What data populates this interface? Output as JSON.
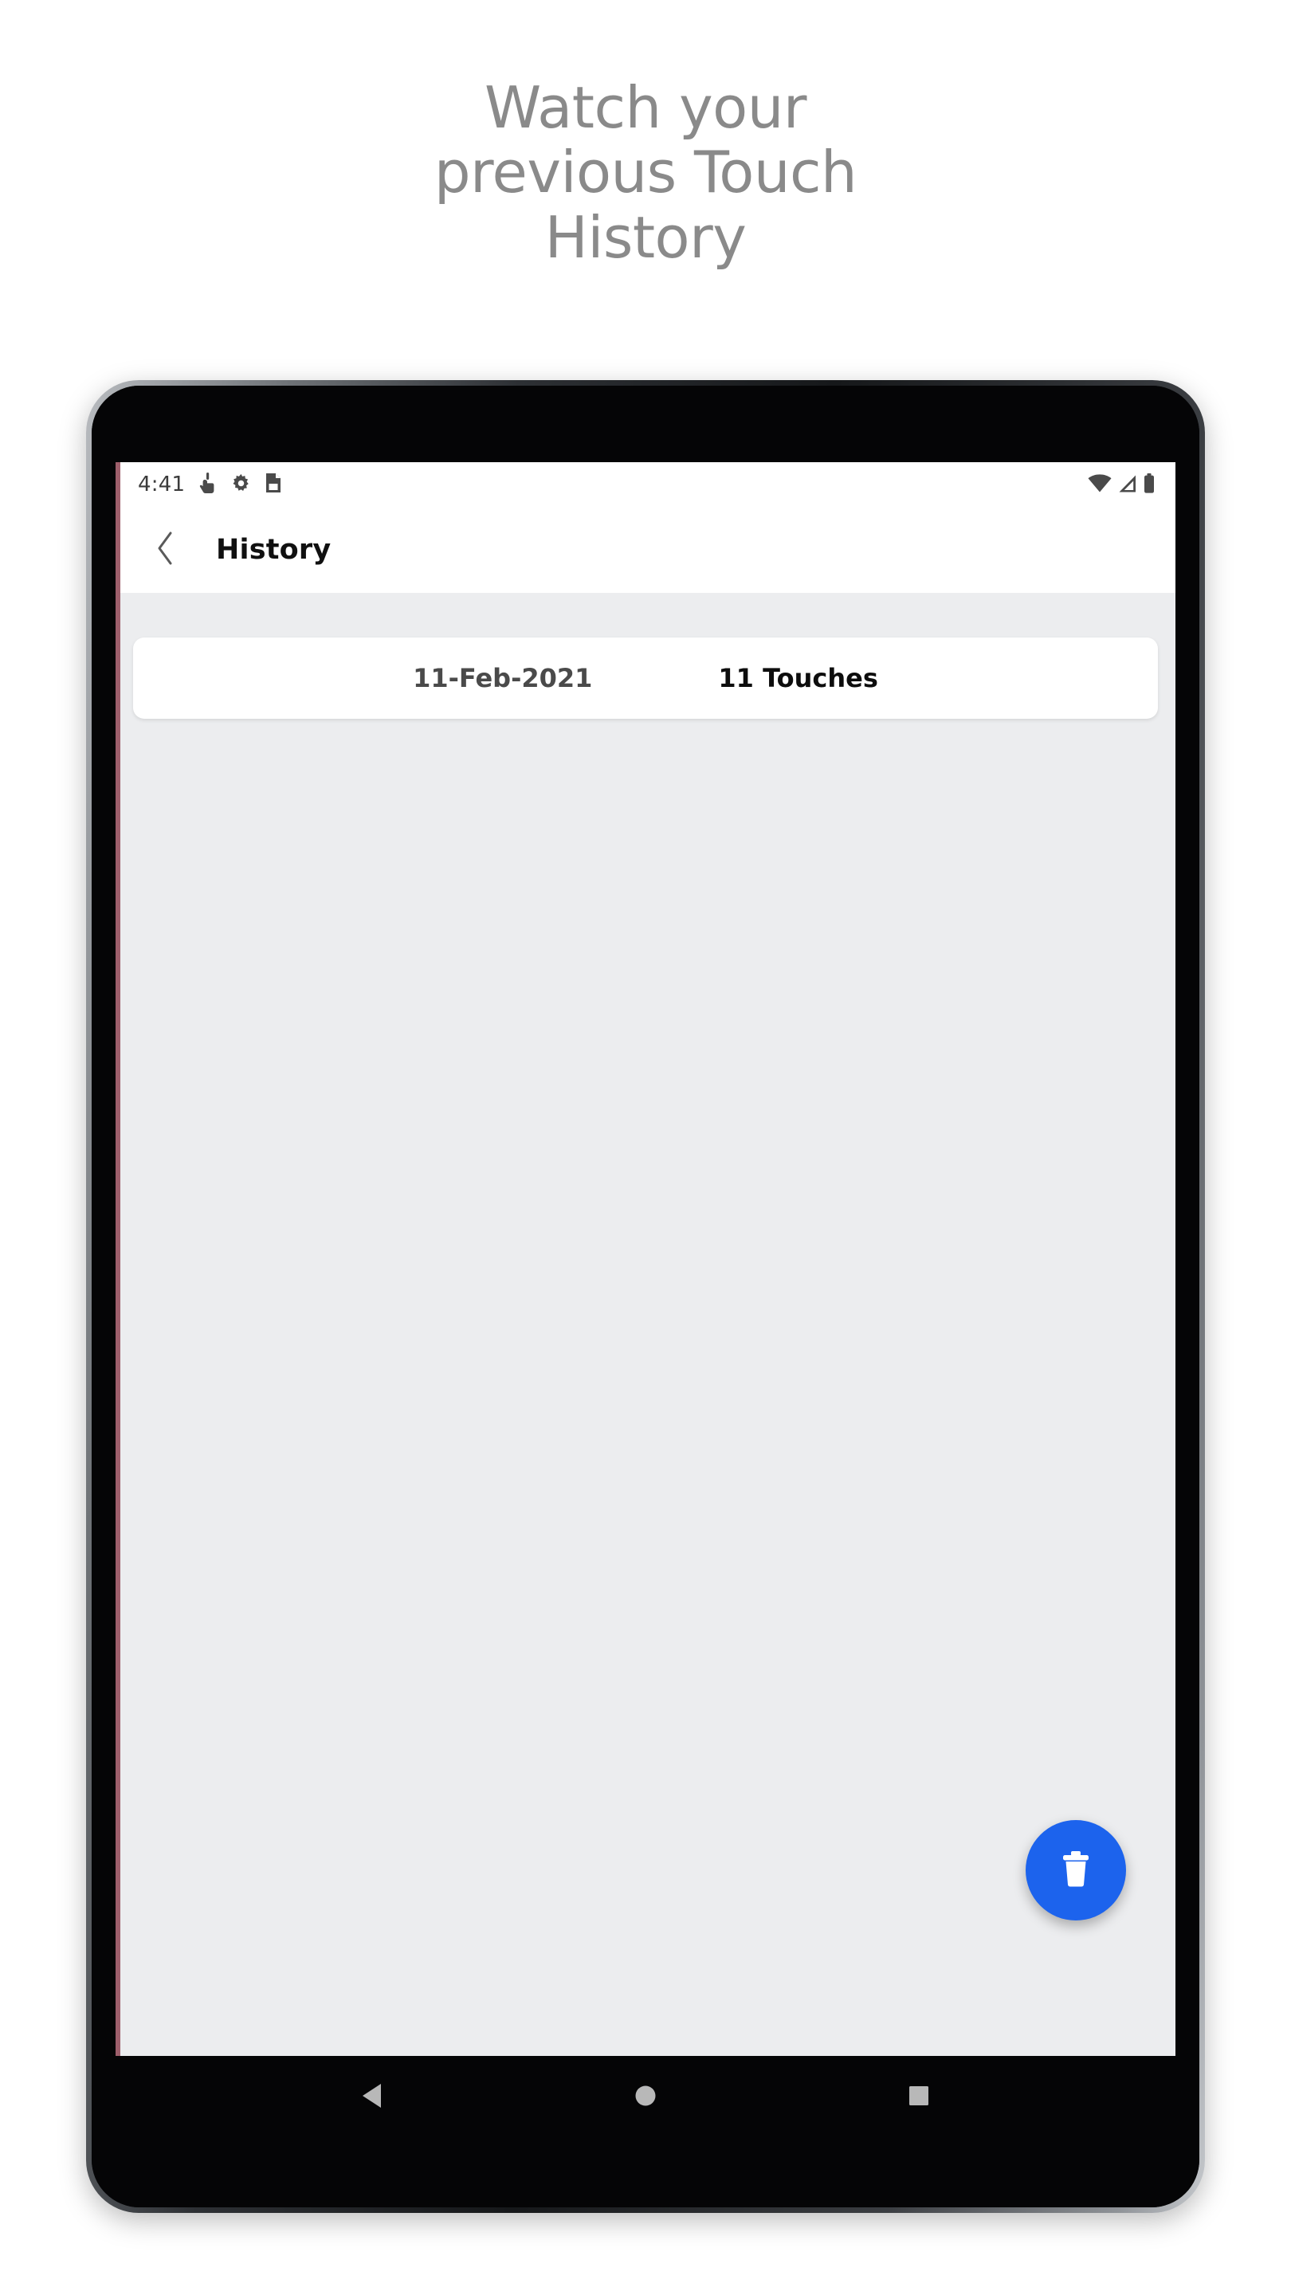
{
  "promo": {
    "headline": "Watch your\nprevious Touch\nHistory",
    "headline_color": "#8a8a8a"
  },
  "phone": {
    "status_bar": {
      "time": "4:41",
      "left_icons": [
        "touch-pointer-icon",
        "gear-icon",
        "document-save-icon"
      ],
      "right_icons": [
        "wifi-icon",
        "cellular-signal-icon",
        "battery-icon"
      ]
    },
    "app_bar": {
      "back_icon": "chevron-left-icon",
      "title": "History"
    },
    "content": {
      "background_color": "#ECEDEF",
      "history_list": [
        {
          "date": "11-Feb-2021",
          "touches": "11 Touches"
        }
      ],
      "fab": {
        "icon": "trash-delete-icon",
        "color": "#1c63ED"
      }
    },
    "nav_bar": {
      "buttons": [
        "back-triangle-icon",
        "home-circle-icon",
        "recents-square-icon"
      ]
    }
  }
}
